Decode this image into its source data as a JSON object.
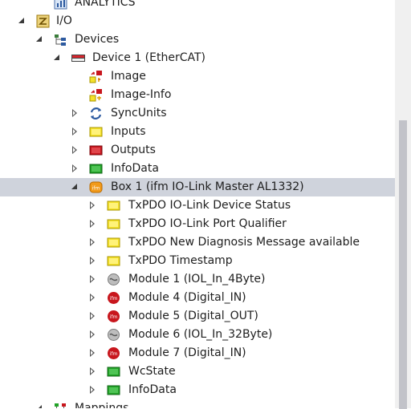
{
  "tree": {
    "items": [
      {
        "label": "ANALYTICS",
        "icon": "analytics-icon",
        "depth": 1,
        "state": "none",
        "selected": false
      },
      {
        "label": "I/O",
        "icon": "io-folder-icon",
        "depth": 0,
        "state": "expanded",
        "selected": false
      },
      {
        "label": "Devices",
        "icon": "devices-icon",
        "depth": 1,
        "state": "expanded",
        "selected": false
      },
      {
        "label": "Device 1 (EtherCAT)",
        "icon": "ethercat-device-icon",
        "depth": 2,
        "state": "expanded",
        "selected": false
      },
      {
        "label": "Image",
        "icon": "image-icon",
        "depth": 3,
        "state": "none",
        "selected": false
      },
      {
        "label": "Image-Info",
        "icon": "image-info-icon",
        "depth": 3,
        "state": "none",
        "selected": false
      },
      {
        "label": "SyncUnits",
        "icon": "syncunits-icon",
        "depth": 3,
        "state": "collapsed",
        "selected": false
      },
      {
        "label": "Inputs",
        "icon": "inputs-icon",
        "depth": 3,
        "state": "collapsed",
        "selected": false
      },
      {
        "label": "Outputs",
        "icon": "outputs-icon",
        "depth": 3,
        "state": "collapsed",
        "selected": false
      },
      {
        "label": "InfoData",
        "icon": "infodata-icon",
        "depth": 3,
        "state": "collapsed",
        "selected": false
      },
      {
        "label": "Box 1 (ifm IO-Link Master AL1332)",
        "icon": "ifm-box-icon",
        "depth": 3,
        "state": "expanded",
        "selected": true
      },
      {
        "label": "TxPDO IO-Link Device Status",
        "icon": "txpdo-icon",
        "depth": 4,
        "state": "collapsed",
        "selected": false
      },
      {
        "label": "TxPDO IO-Link Port Qualifier",
        "icon": "txpdo-icon",
        "depth": 4,
        "state": "collapsed",
        "selected": false
      },
      {
        "label": "TxPDO New Diagnosis Message available",
        "icon": "txpdo-icon",
        "depth": 4,
        "state": "collapsed",
        "selected": false
      },
      {
        "label": "TxPDO Timestamp",
        "icon": "txpdo-icon",
        "depth": 4,
        "state": "collapsed",
        "selected": false
      },
      {
        "label": "Module 1 (IOL_In_4Byte)",
        "icon": "iol-module-icon",
        "depth": 4,
        "state": "collapsed",
        "selected": false
      },
      {
        "label": "Module 4 (Digital_IN)",
        "icon": "ifm-digital-module-icon",
        "depth": 4,
        "state": "collapsed",
        "selected": false
      },
      {
        "label": "Module 5 (Digital_OUT)",
        "icon": "ifm-digital-module-icon",
        "depth": 4,
        "state": "collapsed",
        "selected": false
      },
      {
        "label": "Module 6 (IOL_In_32Byte)",
        "icon": "iol-module-icon",
        "depth": 4,
        "state": "collapsed",
        "selected": false
      },
      {
        "label": "Module 7 (Digital_IN)",
        "icon": "ifm-digital-module-icon",
        "depth": 4,
        "state": "collapsed",
        "selected": false
      },
      {
        "label": "WcState",
        "icon": "wcstate-icon",
        "depth": 4,
        "state": "collapsed",
        "selected": false
      },
      {
        "label": "InfoData",
        "icon": "infodata-icon",
        "depth": 4,
        "state": "collapsed",
        "selected": false
      },
      {
        "label": "Mappings",
        "icon": "mappings-icon",
        "depth": 1,
        "state": "expanded",
        "selected": false
      }
    ]
  },
  "colors": {
    "selection": "#cfd3dc",
    "yellow": "#f5e22a",
    "red": "#c8161d",
    "green": "#22a327",
    "scroll_thumb": "#c2c3c9"
  }
}
